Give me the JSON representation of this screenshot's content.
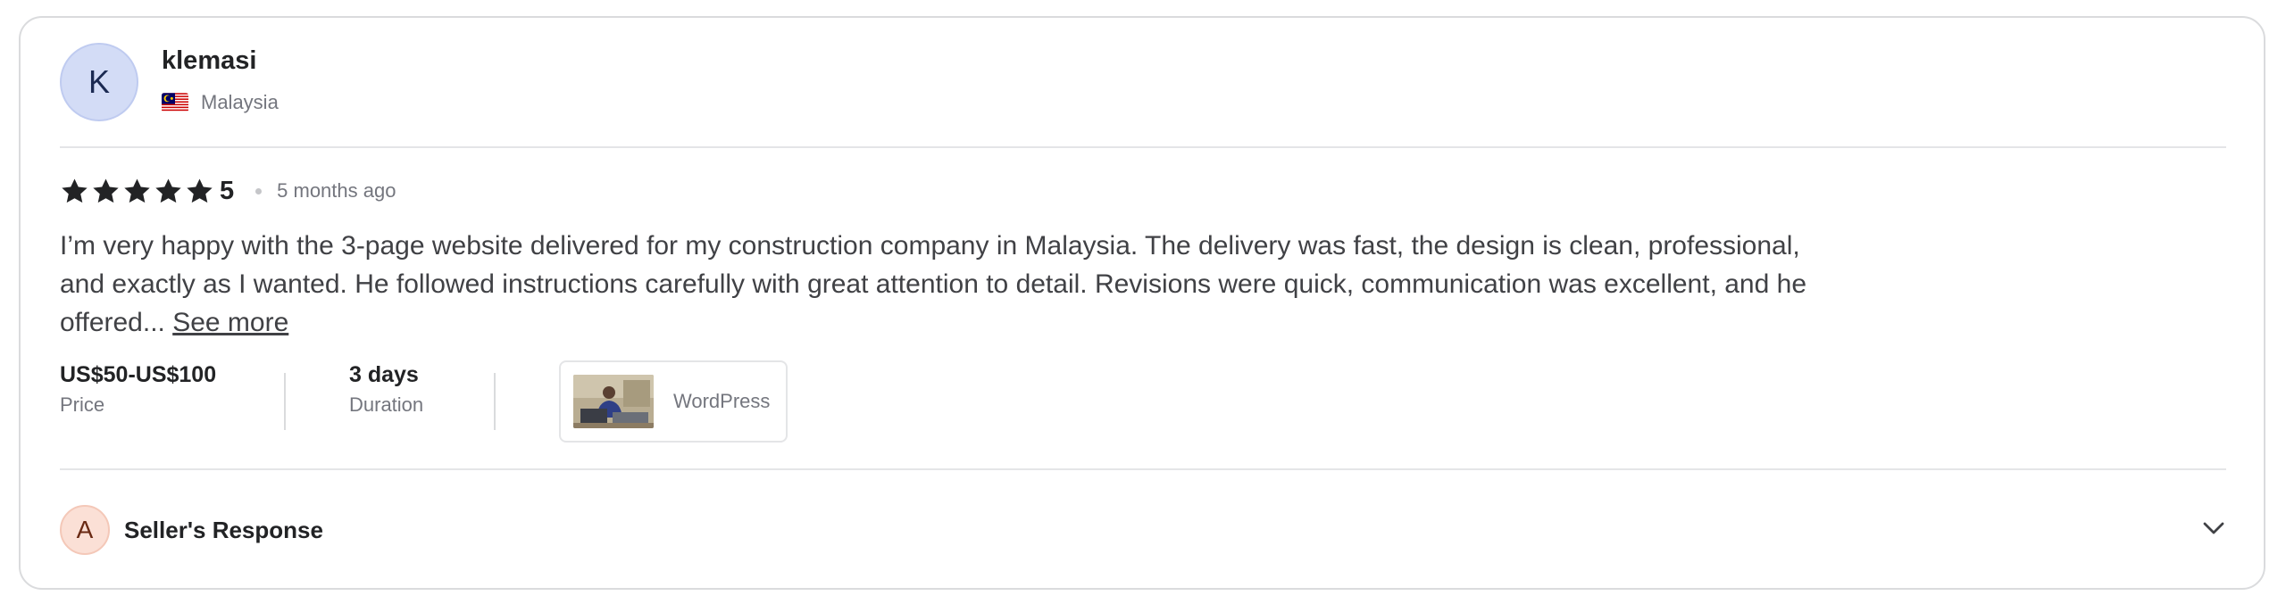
{
  "reviewer": {
    "avatar_initial": "K",
    "username": "klemasi",
    "country": "Malaysia",
    "flag_icon": "malaysia-flag-icon"
  },
  "rating": {
    "stars": 5,
    "value": "5",
    "time_ago": "5 months ago"
  },
  "review": {
    "text": "I’m very happy with the 3-page website delivered for my construction company in Malaysia. The delivery was fast, the design is clean, professional, and exactly as I wanted. He followed instructions carefully with great attention to detail. Revisions were quick, communication was excellent, and he offered... ",
    "see_more": "See more"
  },
  "meta": {
    "price_value": "US$50-US$100",
    "price_label": "Price",
    "duration_value": "3 days",
    "duration_label": "Duration"
  },
  "gig": {
    "name": "WordPress"
  },
  "seller_response": {
    "avatar_initial": "A",
    "title": "Seller's Response"
  },
  "colors": {
    "star": "#222325",
    "reviewer_avatar_bg": "#d3dcf6",
    "seller_avatar_bg": "#fbe0d6",
    "muted_text": "#74767e"
  }
}
